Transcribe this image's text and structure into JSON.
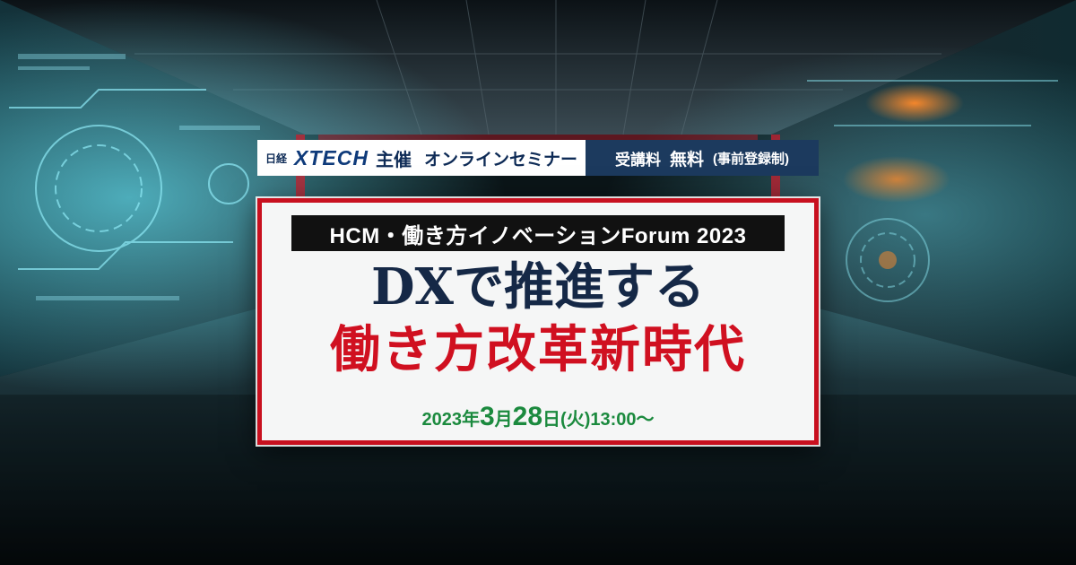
{
  "banner": {
    "brand_small": "日経",
    "brand_name": "XTECH",
    "host": "主催",
    "event_kind": "オンラインセミナー",
    "fee_label": "受講料",
    "fee_value": "無料",
    "fee_note": "(事前登録制)"
  },
  "card": {
    "forum_name": "HCM・働き方イノベーションForum 2023",
    "title_line1": "DXで推進する",
    "title_line2": "働き方改革新時代",
    "date": {
      "year": "2023",
      "year_unit": "年",
      "month": "3",
      "month_unit": "月",
      "day": "28",
      "day_unit": "日",
      "weekday": "(火)",
      "time": "13:00〜"
    }
  },
  "colors": {
    "accent_red": "#c8101f",
    "title_navy": "#152846",
    "date_green": "#1b8a3e",
    "fee_bar": "#1c3a5e"
  }
}
